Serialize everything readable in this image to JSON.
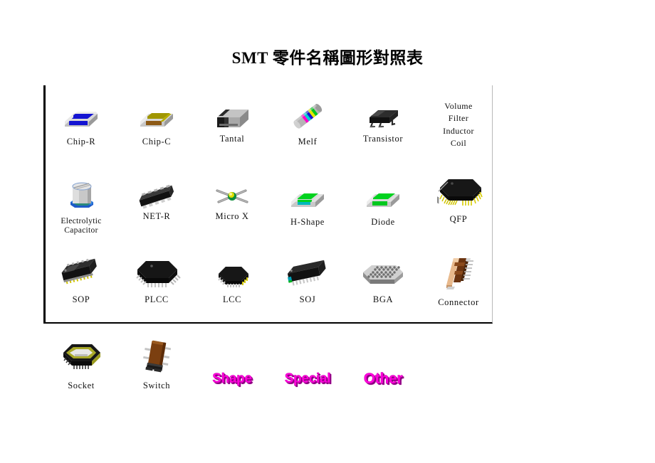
{
  "title": "SMT 零件名稱圖形對照表",
  "colors": {
    "border": "#000000",
    "word_art": "#ff00dd",
    "word_art_shadow": "#8b0080",
    "chip_r_body": "#1414d2",
    "chip_c_body": "#a09600",
    "tantal_body": "#9a9a9a",
    "diode_body": "#00d21e",
    "h_shape_body": "#00d21e",
    "connector_body": "#e8b98c",
    "switch_body": "#7b3f10",
    "socket_ring": "#9a9a1e",
    "lead_gold": "#d2c800"
  },
  "chart_box": {
    "rows": [
      {
        "cells": [
          {
            "label": "Chip-R",
            "icon": "chip-r-icon",
            "type": "image"
          },
          {
            "label": "Chip-C",
            "icon": "chip-c-icon",
            "type": "image"
          },
          {
            "label": "Tantal",
            "icon": "tantal-icon",
            "type": "image"
          },
          {
            "label": "Melf",
            "icon": "melf-icon",
            "type": "image"
          },
          {
            "label": "Transistor",
            "icon": "transistor-icon",
            "type": "image"
          },
          {
            "label": "Volume\nFilter\nInductor\nCoil",
            "icon": "",
            "type": "text"
          }
        ]
      },
      {
        "cells": [
          {
            "label": "Electrolytic\nCapacitor",
            "icon": "electrolytic-capacitor-icon",
            "type": "image"
          },
          {
            "label": "NET-R",
            "icon": "net-r-icon",
            "type": "image"
          },
          {
            "label": "Micro X",
            "icon": "micro-x-icon",
            "type": "image"
          },
          {
            "label": "H-Shape",
            "icon": "h-shape-icon",
            "type": "image"
          },
          {
            "label": "Diode",
            "icon": "diode-icon",
            "type": "image"
          },
          {
            "label": "QFP",
            "icon": "qfp-icon",
            "type": "image"
          }
        ]
      },
      {
        "cells": [
          {
            "label": "SOP",
            "icon": "sop-icon",
            "type": "image"
          },
          {
            "label": "PLCC",
            "icon": "plcc-icon",
            "type": "image"
          },
          {
            "label": "LCC",
            "icon": "lcc-icon",
            "type": "image"
          },
          {
            "label": "SOJ",
            "icon": "soj-icon",
            "type": "image"
          },
          {
            "label": "BGA",
            "icon": "bga-icon",
            "type": "image"
          },
          {
            "label": "Connector",
            "icon": "connector-icon",
            "type": "image"
          }
        ]
      }
    ]
  },
  "bottom_row": {
    "cells": [
      {
        "label": "Socket",
        "icon": "socket-icon",
        "type": "image"
      },
      {
        "label": "Switch",
        "icon": "switch-icon",
        "type": "image"
      },
      {
        "label": "Shape",
        "type": "wordart"
      },
      {
        "label": "Special",
        "type": "wordart"
      },
      {
        "label": "Other",
        "type": "wordart"
      }
    ]
  }
}
